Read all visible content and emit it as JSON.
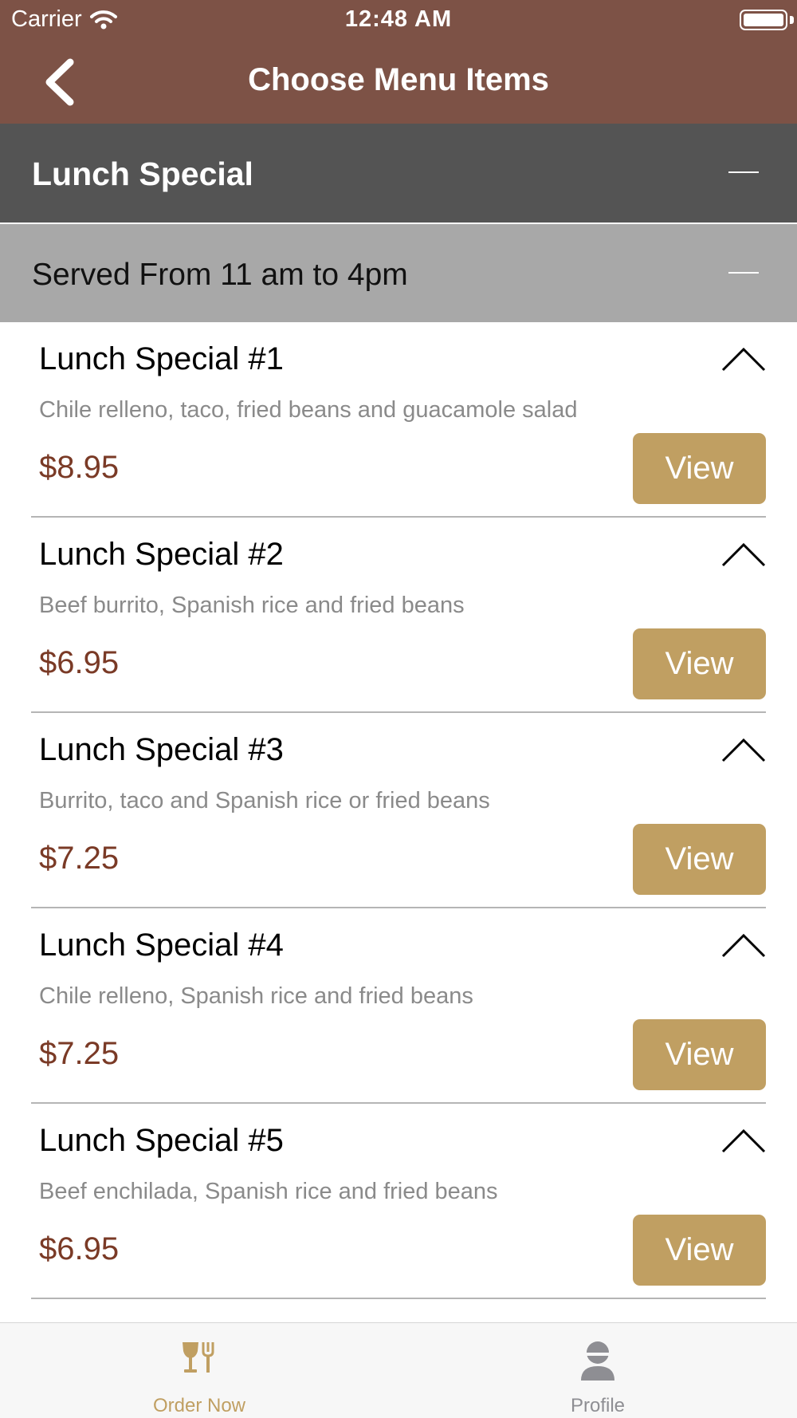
{
  "status_bar": {
    "carrier": "Carrier",
    "time": "12:48 AM"
  },
  "nav": {
    "title": "Choose Menu Items"
  },
  "section": {
    "title": "Lunch Special"
  },
  "subsection": {
    "title": "Served From 11 am to 4pm"
  },
  "items": [
    {
      "name": "Lunch Special #1",
      "description": "Chile relleno, taco, fried beans and guacamole salad",
      "price": "$8.95",
      "button": "View"
    },
    {
      "name": "Lunch Special #2",
      "description": "Beef burrito, Spanish rice and fried beans",
      "price": "$6.95",
      "button": "View"
    },
    {
      "name": "Lunch Special #3",
      "description": "Burrito, taco and Spanish rice or fried beans",
      "price": "$7.25",
      "button": "View"
    },
    {
      "name": "Lunch Special #4",
      "description": "Chile relleno, Spanish rice and fried beans",
      "price": "$7.25",
      "button": "View"
    },
    {
      "name": "Lunch Special #5",
      "description": "Beef enchilada, Spanish rice and fried beans",
      "price": "$6.95",
      "button": "View"
    }
  ],
  "tabs": [
    {
      "label": "Order Now",
      "icon": "wine-fork-icon",
      "active": true
    },
    {
      "label": "Profile",
      "icon": "person-icon",
      "active": false
    }
  ],
  "colors": {
    "nav_bg": "#7d5246",
    "section_bg": "#545454",
    "subsection_bg": "#a8a8a8",
    "button_bg": "#c09f62",
    "price_text": "#7a3a26",
    "tab_active": "#c09f62",
    "tab_inactive": "#8e8e93"
  }
}
